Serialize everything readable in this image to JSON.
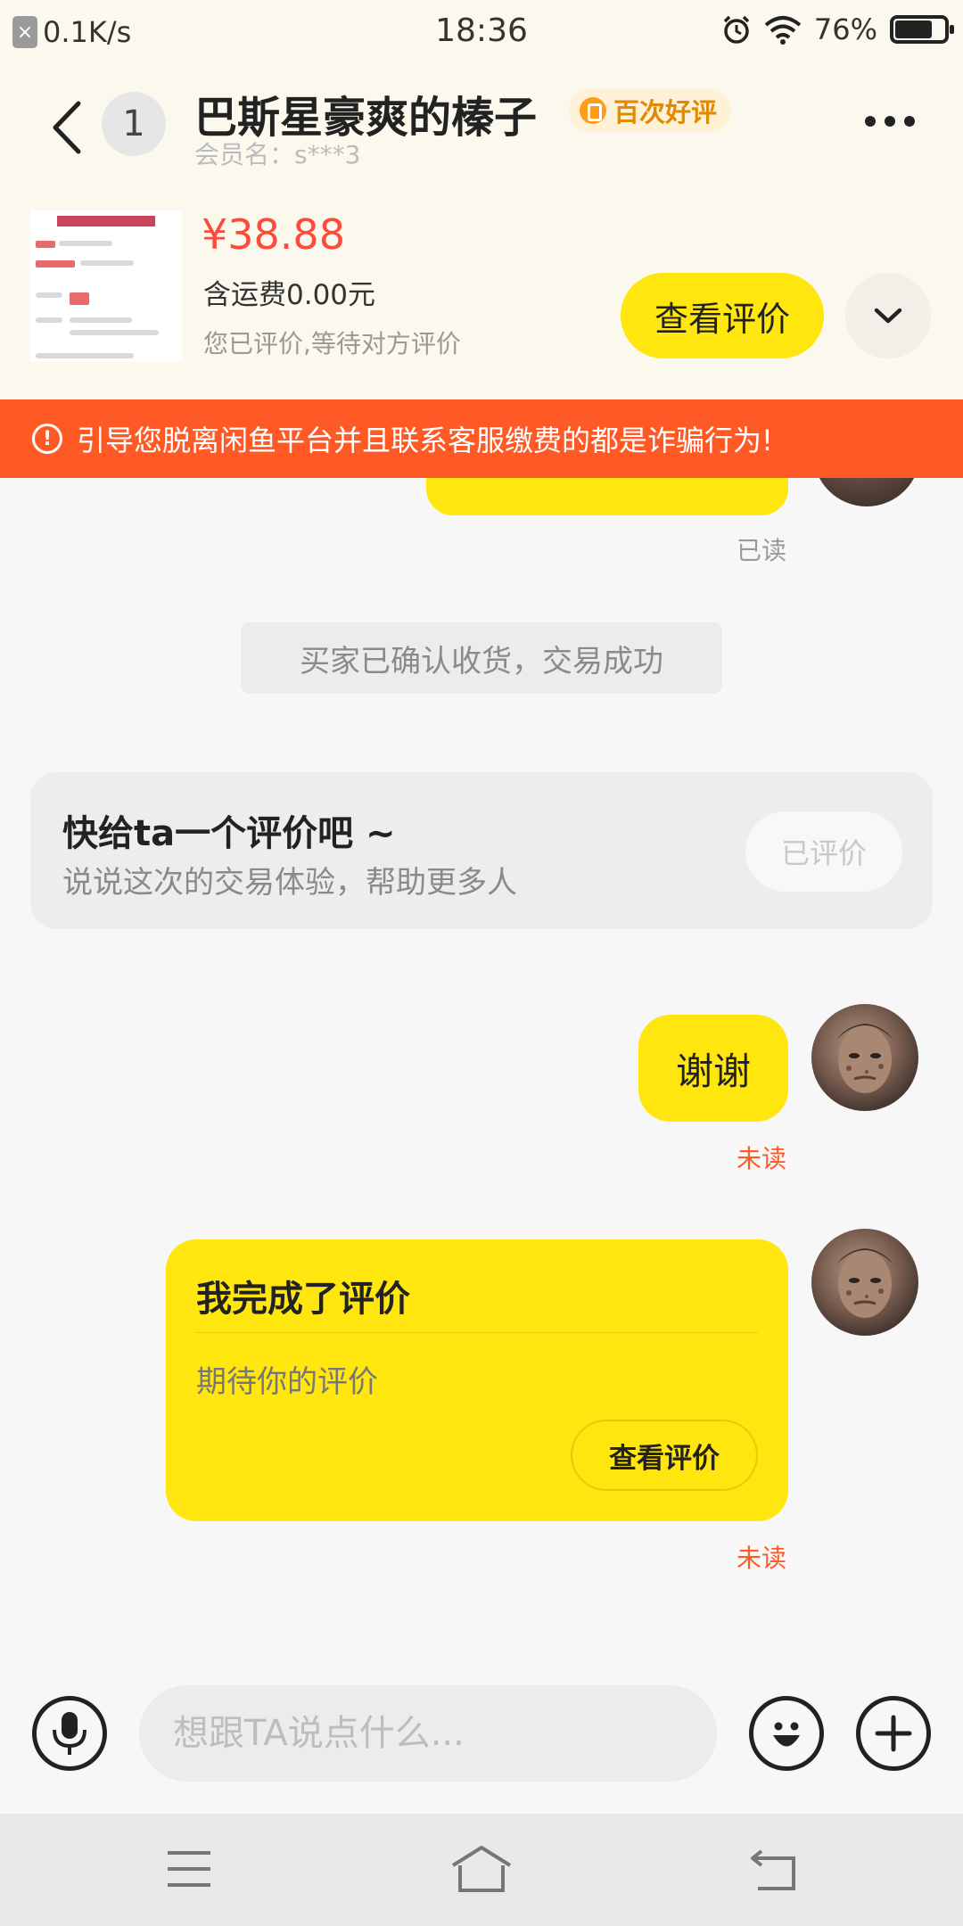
{
  "status_bar": {
    "speed": "0.1K/s",
    "time": "18:36",
    "battery": "76%",
    "battery_level": 0.76,
    "x_icon_label": "×"
  },
  "header": {
    "unread_count": "1",
    "seller_name": "巴斯星豪爽的榛子",
    "badge": "百次好评",
    "member_name": "会员名：s***3"
  },
  "product": {
    "price": "¥38.88",
    "shipping": "含运费0.00元",
    "note": "您已评价,等待对方评价",
    "view_review_label": "查看评价"
  },
  "warning": {
    "icon": "!",
    "text": "引导您脱离闲鱼平台并且联系客服缴费的都是诈骗行为!"
  },
  "chat": {
    "read_status_1": "已读",
    "system_message": "买家已确认收货，交易成功",
    "review_prompt": {
      "title": "快给ta一个评价吧 ~",
      "subtitle": "说说这次的交易体验，帮助更多人",
      "button": "已评价"
    },
    "thanks_message": "谢谢",
    "read_status_2": "未读",
    "review_done_card": {
      "title": "我完成了评价",
      "subtitle": "期待你的评价",
      "button": "查看评价"
    },
    "read_status_3": "未读"
  },
  "input": {
    "placeholder": "想跟TA说点什么..."
  },
  "colors": {
    "accent_yellow": "#ffe60f",
    "warning_orange": "#ff5a26",
    "price_red": "#ff4a39",
    "unread_red": "#ff5a26",
    "read_gray": "#999999"
  }
}
